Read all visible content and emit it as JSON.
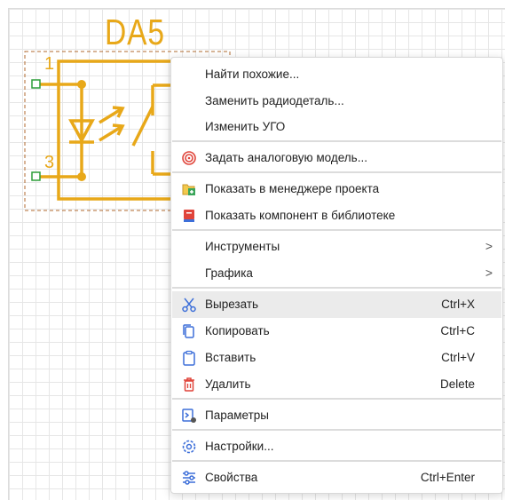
{
  "component": {
    "reference": "DA5",
    "pin_1": "1",
    "pin_3": "3"
  },
  "menu": {
    "items": [
      {
        "label": "Найти похожие...",
        "icon": "none",
        "shortcut": ""
      },
      {
        "label": "Заменить радиодеталь...",
        "icon": "none",
        "shortcut": ""
      },
      {
        "label": "Изменить УГО",
        "icon": "none",
        "shortcut": ""
      },
      {
        "label": "Задать аналоговую модель...",
        "icon": "analog-model-icon",
        "shortcut": ""
      },
      {
        "label": "Показать в менеджере проекта",
        "icon": "project-manager-icon",
        "shortcut": ""
      },
      {
        "label": "Показать компонент в библиотеке",
        "icon": "library-icon",
        "shortcut": ""
      },
      {
        "label": "Инструменты",
        "icon": "none",
        "shortcut": "",
        "submenu_arrow": ">"
      },
      {
        "label": "Графика",
        "icon": "none",
        "shortcut": "",
        "submenu_arrow": ">"
      },
      {
        "label": "Вырезать",
        "icon": "scissors-icon",
        "shortcut": "Ctrl+X",
        "highlighted": true
      },
      {
        "label": "Копировать",
        "icon": "copy-icon",
        "shortcut": "Ctrl+C"
      },
      {
        "label": "Вставить",
        "icon": "clipboard-icon",
        "shortcut": "Ctrl+V"
      },
      {
        "label": "Удалить",
        "icon": "trash-icon",
        "shortcut": "Delete"
      },
      {
        "label": "Параметры",
        "icon": "parameters-icon",
        "shortcut": ""
      },
      {
        "label": "Настройки...",
        "icon": "gear-icon",
        "shortcut": ""
      },
      {
        "label": "Свойства",
        "icon": "sliders-icon",
        "shortcut": "Ctrl+Enter"
      }
    ]
  },
  "colors": {
    "component": "#e8a819",
    "pin_marker": "#2e9e3a",
    "highlight": "#ebebeb",
    "icon_blue": "#3d6fd9",
    "icon_red": "#e0443a"
  }
}
